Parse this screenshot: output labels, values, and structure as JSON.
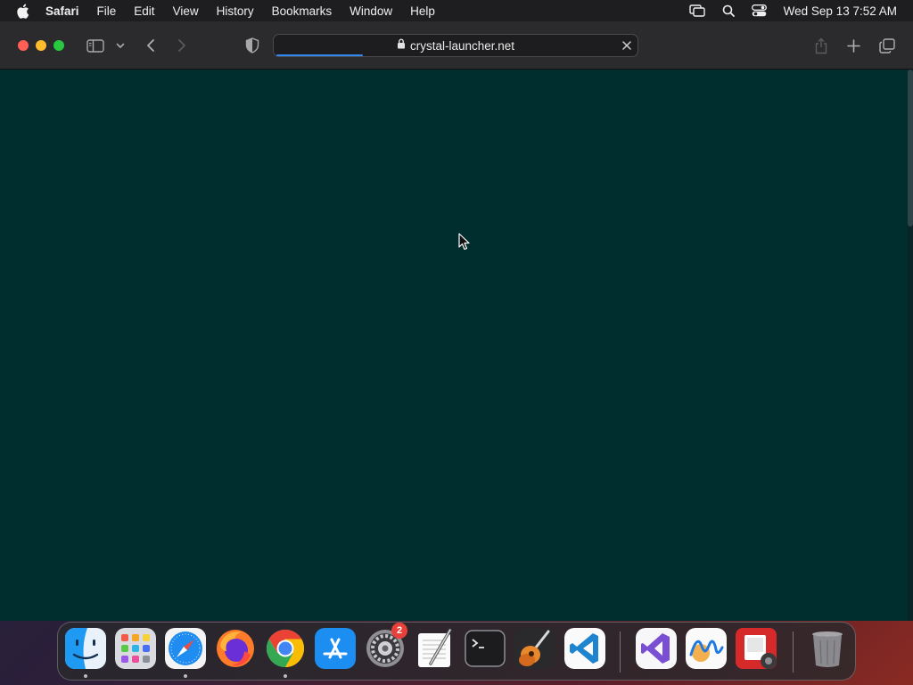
{
  "menubar": {
    "app_name": "Safari",
    "menus": [
      "File",
      "Edit",
      "View",
      "History",
      "Bookmarks",
      "Window",
      "Help"
    ],
    "clock": "Wed Sep 13  7:52 AM"
  },
  "browser": {
    "url": "crystal-launcher.net",
    "load_progress": 0.24,
    "page_background": "#002d2e"
  },
  "dock": {
    "apps": [
      "finder",
      "launchpad",
      "safari",
      "firefox",
      "chrome",
      "app-store",
      "system-settings",
      "textedit",
      "terminal",
      "garageband",
      "vscode",
      "visual-studio",
      "freeform",
      "photo-booth",
      "trash"
    ],
    "settings_badge": "2"
  }
}
